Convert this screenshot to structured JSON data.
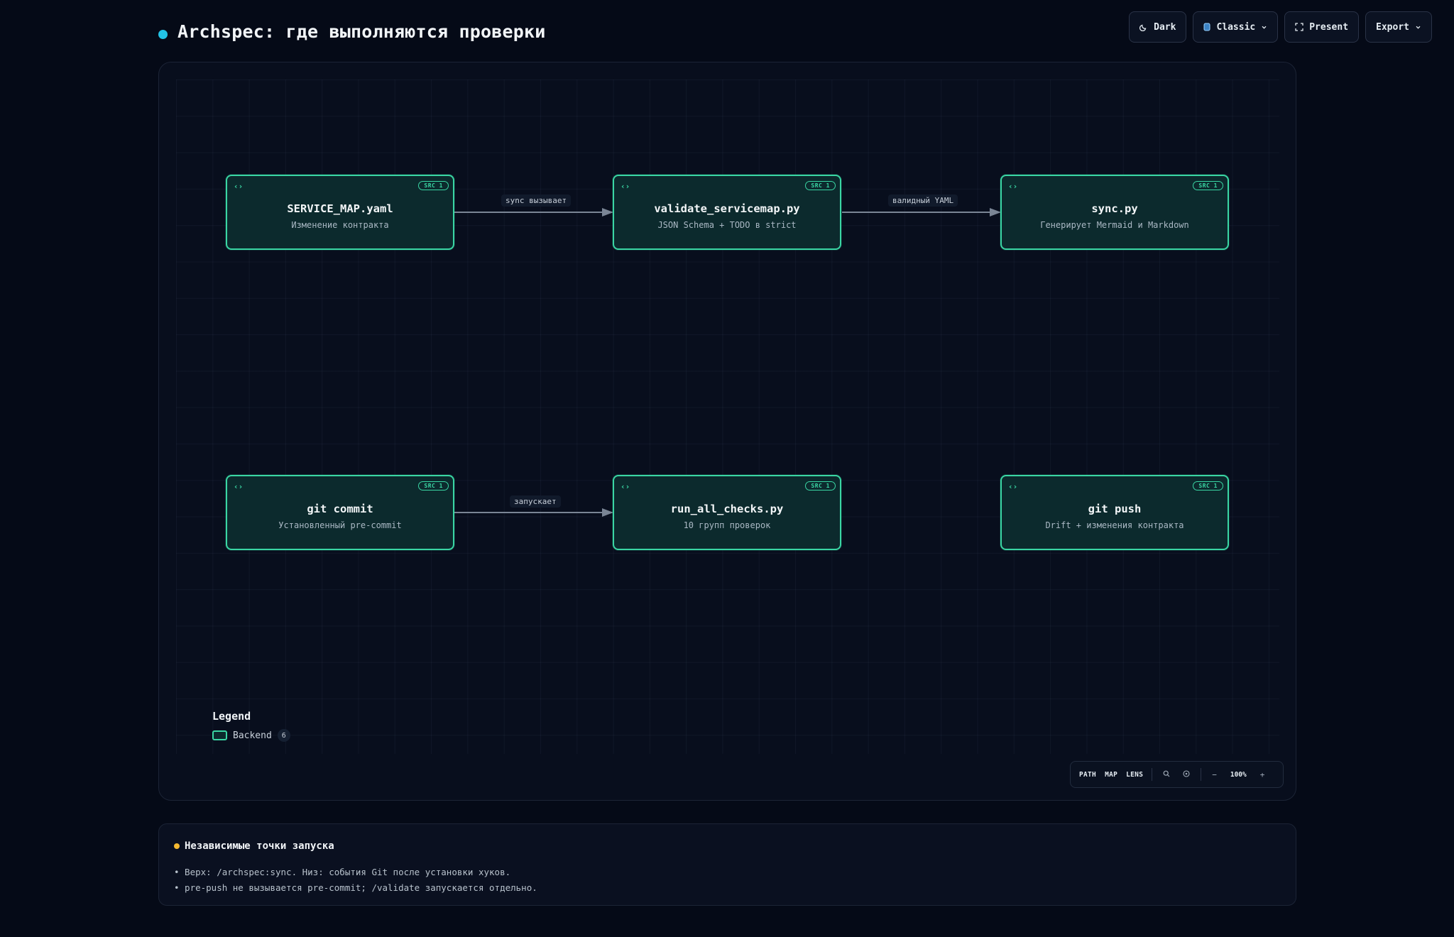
{
  "header": {
    "title": "Archspec: где выполняются проверки",
    "buttons": {
      "theme": "Dark",
      "style": "Classic",
      "present": "Present",
      "export": "Export"
    }
  },
  "diagram": {
    "nodes": [
      {
        "id": "service_map",
        "title": "SERVICE_MAP.yaml",
        "subtitle": "Изменение контракта",
        "badge": "SRC 1",
        "icon": "code-icon"
      },
      {
        "id": "validate",
        "title": "validate_servicemap.py",
        "subtitle": "JSON Schema + TODO в strict",
        "badge": "SRC 1",
        "icon": "code-icon"
      },
      {
        "id": "sync",
        "title": "sync.py",
        "subtitle": "Генерирует Mermaid и Markdown",
        "badge": "SRC 1",
        "icon": "code-icon"
      },
      {
        "id": "git_commit",
        "title": "git commit",
        "subtitle": "Установленный pre-commit",
        "badge": "SRC 1",
        "icon": "code-icon"
      },
      {
        "id": "run_all",
        "title": "run_all_checks.py",
        "subtitle": "10 групп проверок",
        "badge": "SRC 1",
        "icon": "code-icon"
      },
      {
        "id": "git_push",
        "title": "git push",
        "subtitle": "Drift + изменения контракта",
        "badge": "SRC 1",
        "icon": "code-icon"
      }
    ],
    "edges": [
      {
        "from": "service_map",
        "to": "validate",
        "label": "sync вызывает"
      },
      {
        "from": "validate",
        "to": "sync",
        "label": "валидный YAML"
      },
      {
        "from": "git_commit",
        "to": "run_all",
        "label": "запускает"
      }
    ],
    "colors": {
      "node_border": "#3ad6a4",
      "node_fill": "#0c2a2d",
      "edge": "#7a8595"
    }
  },
  "legend": {
    "title": "Legend",
    "items": [
      {
        "label": "Backend",
        "count": "6"
      }
    ]
  },
  "controls": {
    "path": "PATH",
    "map": "MAP",
    "lens": "LENS",
    "zoom": "100%",
    "minus": "−",
    "plus": "+"
  },
  "notes": {
    "title": "Независимые точки запуска",
    "items": [
      "• Верх: /archspec:sync. Низ: события Git после установки хуков.",
      "• pre-push не вызывается pre-commit; /validate запускается отдельно."
    ],
    "accent": "#f5b931"
  }
}
